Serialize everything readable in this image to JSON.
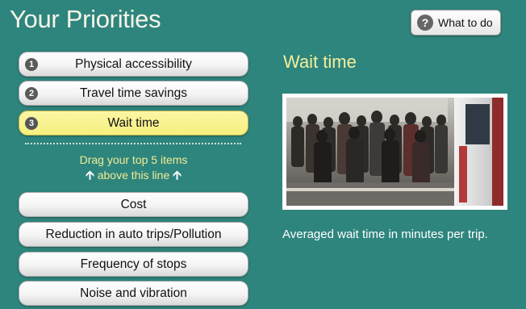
{
  "header": {
    "title": "Your Priorities",
    "help_label": "What to do",
    "help_icon": "question-circle-icon"
  },
  "ranked_items": [
    {
      "rank": "1",
      "label": "Physical accessibility"
    },
    {
      "rank": "2",
      "label": "Travel time savings"
    },
    {
      "rank": "3",
      "label": "Wait time",
      "selected": true
    }
  ],
  "drag_hint": {
    "line1": "Drag your top 5 items",
    "line2": "above this line",
    "arrow_icon": "up-arrow-icon"
  },
  "unranked_items": [
    {
      "label": "Cost"
    },
    {
      "label": "Reduction in auto trips/Pollution"
    },
    {
      "label": "Frequency of stops"
    },
    {
      "label": "Noise and vibration"
    }
  ],
  "detail": {
    "title": "Wait time",
    "description": "Averaged wait time in minutes per trip.",
    "image_subject": "crowded-train-platform"
  },
  "colors": {
    "background": "#2e857d",
    "selected_item": "#f6ef7e",
    "accent_text": "#f3ef9c"
  }
}
